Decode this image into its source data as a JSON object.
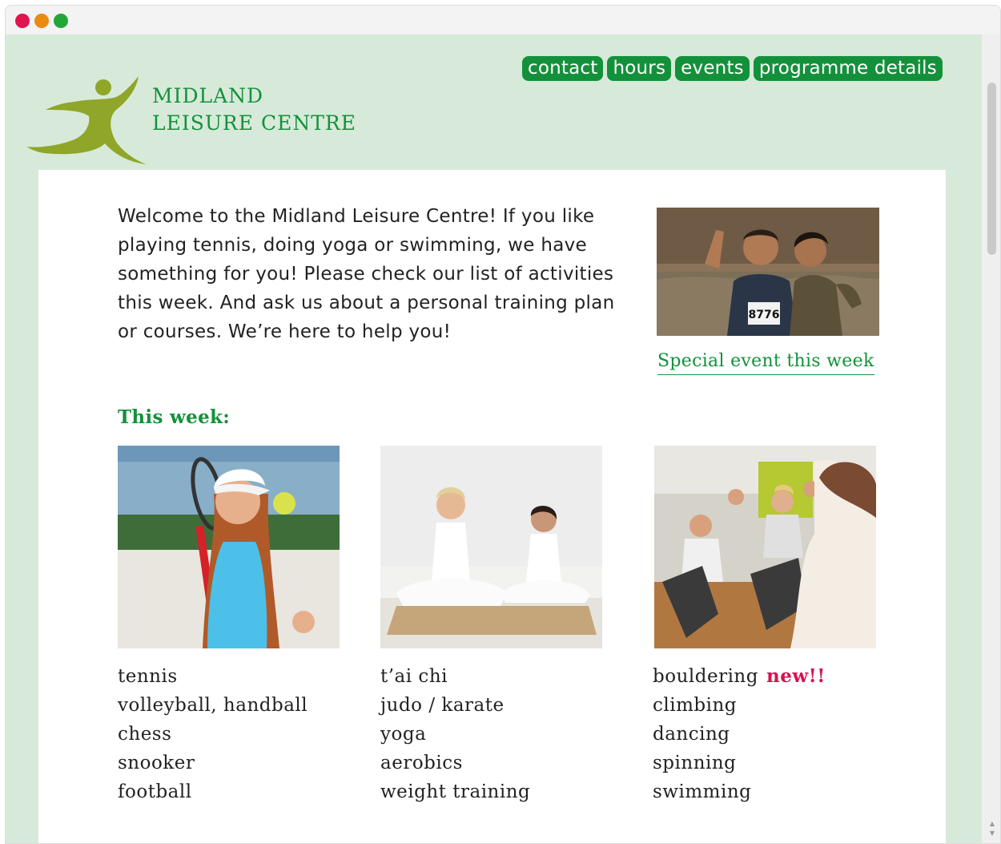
{
  "colors": {
    "brand_green": "#13913a",
    "logo_green": "#8fa628",
    "page_bg": "#d7ead9",
    "new_badge": "#d8124e",
    "window_red": "#e0144f",
    "window_orange": "#e98b12",
    "window_green": "#21a63a"
  },
  "nav": {
    "items": [
      {
        "label": "contact"
      },
      {
        "label": "hours"
      },
      {
        "label": "events"
      },
      {
        "label": "programme details"
      }
    ]
  },
  "brand": {
    "line1": "MIDLAND",
    "line2": "LEISURE CENTRE"
  },
  "intro": {
    "text": "Welcome to the Midland Leisure Centre! If you like playing tennis, doing yoga or swimming, we have something for you! Please check our list of activities this week. And ask us about a personal training plan or courses. We’re here to help you!"
  },
  "event": {
    "link_label": "Special event this week",
    "bib_number": "8776"
  },
  "week": {
    "heading": "This week:",
    "columns": [
      {
        "items": [
          "tennis",
          "volleyball, handball",
          "chess",
          "snooker",
          "football"
        ]
      },
      {
        "items": [
          "t’ai chi",
          "judo / karate",
          "yoga",
          "aerobics",
          "weight training"
        ]
      },
      {
        "items": [
          "bouldering",
          "climbing",
          "dancing",
          "spinning",
          "swimming"
        ],
        "new_label": "new!!"
      }
    ]
  },
  "icons": {
    "logo": "running-figure-logo",
    "scroll_up": "arrow-up-icon",
    "scroll_down": "arrow-down-icon"
  }
}
